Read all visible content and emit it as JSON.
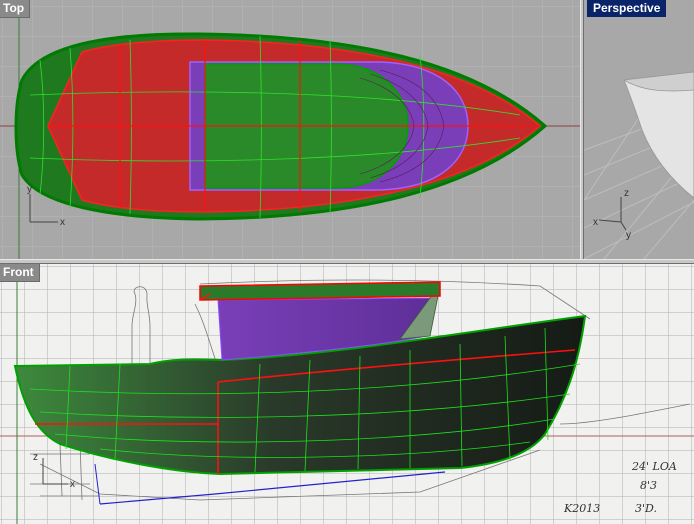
{
  "viewports": {
    "top": {
      "title": "Top"
    },
    "perspective": {
      "title": "Perspective"
    },
    "front": {
      "title": "Front"
    }
  },
  "axes": {
    "top": {
      "x": "x",
      "y": "y"
    },
    "perspective": {
      "x": "x",
      "y": "y",
      "z": "z"
    },
    "front": {
      "x": "x",
      "z": "z"
    }
  },
  "sketch_notes": {
    "loa": "24' LOA",
    "beam": "8'3",
    "draft": "3'D.",
    "signature": "K2013"
  },
  "colors": {
    "viewport_bg": "#a8a8a8",
    "active_tab": "#0a246a",
    "hull_fill": "#1f7a1f",
    "deck_fill": "#c42a2a",
    "cabin_fill": "#7a3fb8",
    "edge_red": "#ff0000",
    "edge_green": "#00c000",
    "edge_blue": "#2222cc"
  }
}
